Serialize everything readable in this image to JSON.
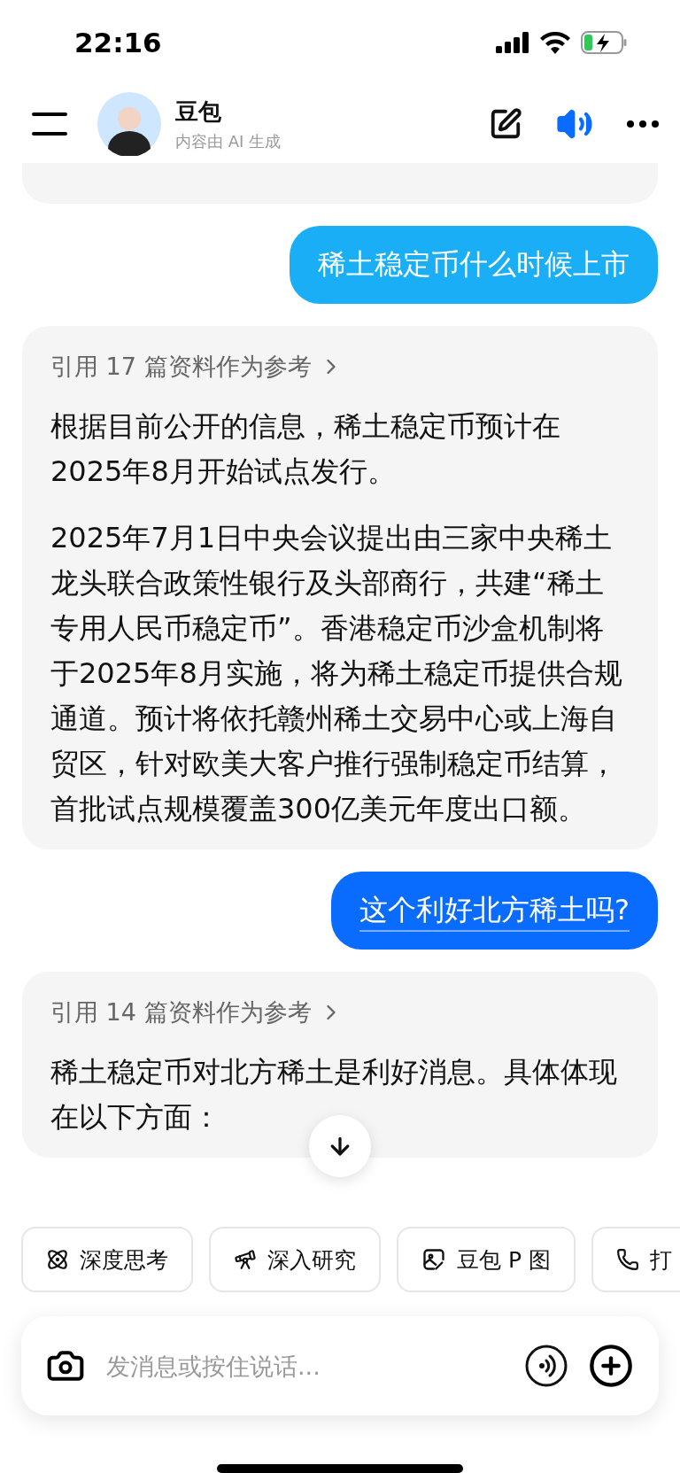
{
  "status_bar": {
    "time": "22:16"
  },
  "header": {
    "title": "豆包",
    "subtitle": "内容由 AI 生成",
    "voice_on": true
  },
  "messages": [
    {
      "kind": "assistant_tail"
    },
    {
      "kind": "user",
      "text": "稀土稳定币什么时候上市",
      "color": "#1aaef7",
      "underlined": false
    },
    {
      "kind": "assistant",
      "citation": "引用 17 篇资料作为参考",
      "paragraphs": [
        "根据目前公开的信息，稀土稳定币预计在2025年8月开始试点发行。",
        "2025年7月1日中央会议提出由三家中央稀土龙头联合政策性银行及头部商行，共建“稀土专用人民币稳定币”。香港稳定币沙盒机制将于2025年8月实施，将为稀土稳定币提供合规通道。预计将依托赣州稀土交易中心或上海自贸区，针对欧美大客户推行强制稳定币结算，首批试点规模覆盖300亿美元年度出口额。"
      ]
    },
    {
      "kind": "user",
      "text": "这个利好北方稀土吗?",
      "color": "#0a6cff",
      "underlined": true
    },
    {
      "kind": "assistant",
      "citation": "引用 14 篇资料作为参考",
      "paragraphs": [
        "稀土稳定币对北方稀土是利好消息。具体体现在以下方面："
      ]
    }
  ],
  "chips": [
    {
      "label": "深度思考",
      "kind": "atom"
    },
    {
      "label": "深入研究",
      "kind": "telescope"
    },
    {
      "label": "豆包 P 图",
      "kind": "image"
    },
    {
      "label": "打",
      "kind": "phone"
    }
  ],
  "composer": {
    "placeholder": "发消息或按住说话..."
  }
}
